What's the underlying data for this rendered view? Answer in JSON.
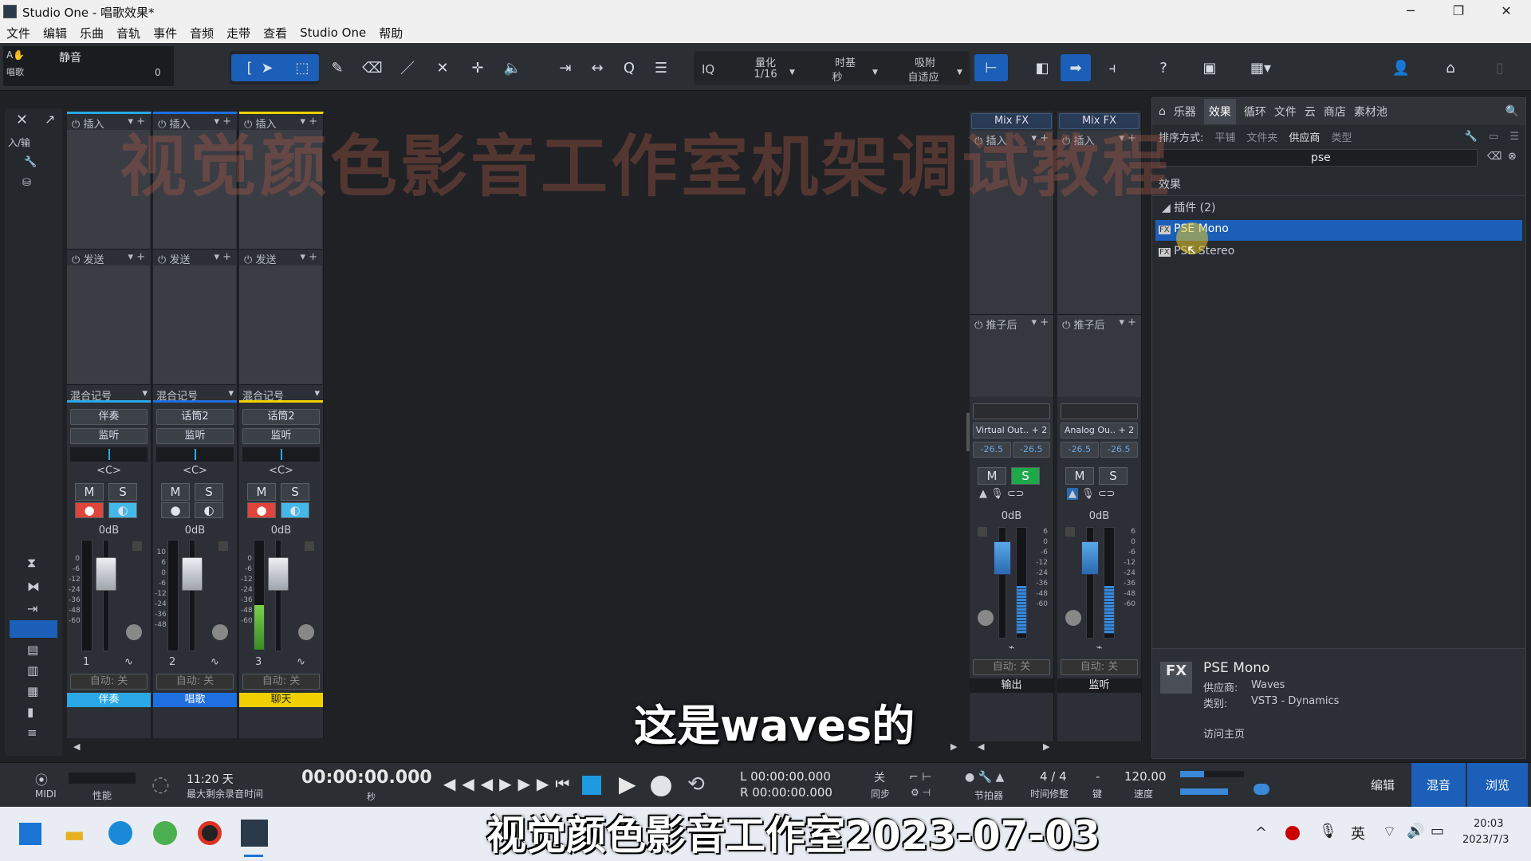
{
  "window": {
    "title": "Studio One - 唱歌效果*"
  },
  "menu": [
    "文件",
    "编辑",
    "乐曲",
    "音轨",
    "事件",
    "音频",
    "走带",
    "查看",
    "Studio One",
    "帮助"
  ],
  "toolbar": {
    "track_label": "静音",
    "track_sub": "唱歌",
    "track_value": "0",
    "quantize_label": "量化",
    "quantize_value": "1/16",
    "timebase_label": "时基",
    "timebase_value": "秒",
    "snap_label": "吸附",
    "snap_value": "自适应",
    "iq_label": "IQ"
  },
  "left_strip": {
    "io_label": "入/输"
  },
  "channels": [
    {
      "insert": "插入",
      "send": "发送",
      "mix_label": "混合记号",
      "input": "伴奏",
      "monitor": "监听",
      "pan": "<C>",
      "m": "M",
      "s": "S",
      "db": "0dB",
      "num": "1",
      "auto": "自动: 关",
      "name": "伴奏",
      "color": "#2aa8e8",
      "rec": true
    },
    {
      "insert": "插入",
      "send": "发送",
      "mix_label": "混合记号",
      "input": "话筒2",
      "monitor": "监听",
      "pan": "<C>",
      "m": "M",
      "s": "S",
      "db": "0dB",
      "num": "2",
      "auto": "自动: 关",
      "name": "唱歌",
      "color": "#1e6fe0",
      "rec": false
    },
    {
      "insert": "插入",
      "send": "发送",
      "mix_label": "混合记号",
      "input": "话筒2",
      "monitor": "监听",
      "pan": "<C>",
      "m": "M",
      "s": "S",
      "db": "0dB",
      "num": "3",
      "auto": "自动: 关",
      "name": "聊天",
      "color": "#f0d000",
      "rec": true
    }
  ],
  "buses": [
    {
      "mixfx": "Mix FX",
      "insert": "插入",
      "post": "推子后",
      "output": "Virtual Out.. + 2",
      "lvl1": "-26.5",
      "lvl2": "-26.5",
      "m": "M",
      "s": "S",
      "db": "0dB",
      "auto": "自动: 关",
      "name": "输出",
      "solo_on": true
    },
    {
      "mixfx": "Mix FX",
      "insert": "插入",
      "post": "推子后",
      "output": "Analog Ou.. + 2",
      "lvl1": "-26.5",
      "lvl2": "-26.5",
      "m": "M",
      "s": "S",
      "db": "0dB",
      "auto": "自动: 关",
      "name": "监听",
      "solo_on": false
    }
  ],
  "fader_scale": [
    "0",
    "-6",
    "-12",
    "-24",
    "-36",
    "-48",
    "-60"
  ],
  "fader_scale_b": [
    "6",
    "0",
    "-6",
    "-12",
    "-24",
    "-36",
    "-48",
    "-60"
  ],
  "browser": {
    "tabs": [
      "乐器",
      "效果",
      "循环",
      "文件",
      "云",
      "商店",
      "素材池"
    ],
    "sort_label": "排序方式:",
    "sort_opts": [
      "平铺",
      "文件夹",
      "供应商",
      "类型"
    ],
    "search_value": "pse",
    "section": "效果",
    "folder": "插件 (2)",
    "items": [
      "PSE Mono",
      "PSE Stereo"
    ],
    "info": {
      "name": "PSE Mono",
      "vendor_label": "供应商:",
      "vendor": "Waves",
      "cat_label": "类别:",
      "category": "VST3 - Dynamics",
      "home": "访问主页"
    }
  },
  "transport": {
    "midi": "MIDI",
    "perf": "性能",
    "rec_time": "11:20 天",
    "rec_time_label": "最大剩余录音时间",
    "time": "00:00:00.000",
    "time_unit": "秒",
    "loop_l": "L   00:00:00.000",
    "loop_r": "R   00:00:00.000",
    "sync_val": "关",
    "sync_label": "同步",
    "metronome_label": "节拍器",
    "sig": "4 / 4",
    "sig_label": "时间修整",
    "key_val": "-",
    "key_label": "键",
    "tempo": "120.00",
    "tempo_label": "速度",
    "view_edit": "编辑",
    "view_mix": "混音",
    "view_browse": "浏览"
  },
  "overlay": {
    "watermark": "视觉颜色影音工作室机架调试教程",
    "subtitle": "这是waves的",
    "caption": "视觉颜色影音工作室2023-07-03"
  },
  "taskbar": {
    "ime": "英",
    "time": "20:03",
    "date": "2023/7/3"
  },
  "colors": {
    "accent": "#1b5fb8",
    "rec": "#e0443a",
    "solo": "#1fa84a"
  }
}
